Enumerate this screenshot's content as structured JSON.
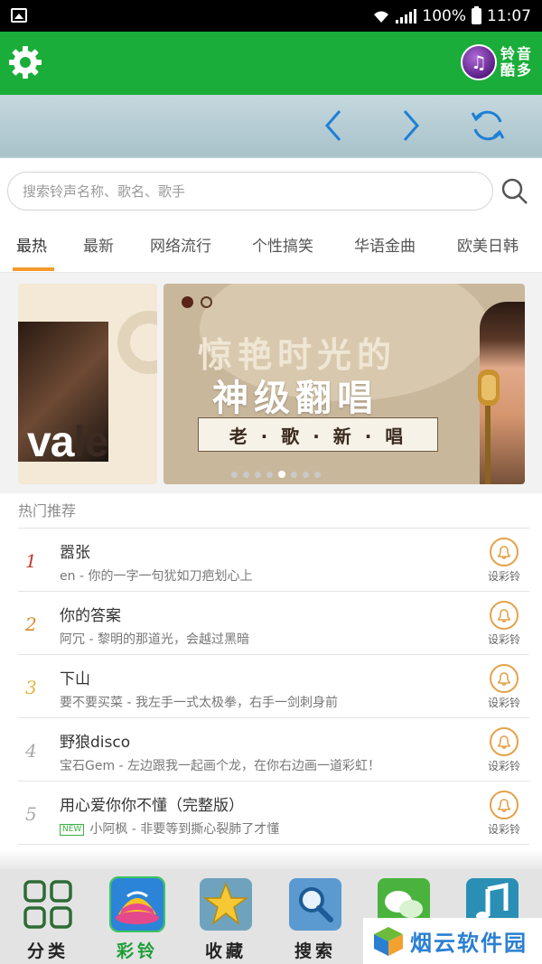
{
  "status_bar": {
    "battery": "100%",
    "time": "11:07"
  },
  "header": {
    "logo_text": [
      "铃",
      "音",
      "酷",
      "多"
    ]
  },
  "search": {
    "placeholder": "搜索铃声名称、歌名、歌手"
  },
  "tabs": [
    {
      "label": "最热",
      "active": true
    },
    {
      "label": "最新"
    },
    {
      "label": "网络流行"
    },
    {
      "label": "个性搞笑"
    },
    {
      "label": "华语金曲"
    },
    {
      "label": "欧美日韩"
    }
  ],
  "banner": {
    "left_text_a": "va",
    "left_text_b": "le",
    "main_line1": "惊艳时光的",
    "main_line2": "神级翻唱",
    "main_tag": "老 · 歌 · 新 · 唱",
    "dot_count": 8,
    "active_dot": 4
  },
  "hot": {
    "title": "热门推荐",
    "items": [
      {
        "rank": "1",
        "rank_color": "#c0392b",
        "title": "嚣张",
        "sub": "en - 你的一字一句犹如刀疤划心上",
        "action": "设彩铃"
      },
      {
        "rank": "2",
        "rank_color": "#d98a2b",
        "title": "你的答案",
        "sub": "阿冗 - 黎明的那道光，会越过黑暗",
        "action": "设彩铃"
      },
      {
        "rank": "3",
        "rank_color": "#e0b43a",
        "title": "下山",
        "sub": "要不要买菜 - 我左手一式太极拳，右手一剑刺身前",
        "action": "设彩铃"
      },
      {
        "rank": "4",
        "rank_color": "#aaaaaa",
        "title": "野狼disco",
        "sub": "宝石Gem - 左边跟我一起画个龙，在你右边画一道彩虹！",
        "action": "设彩铃"
      },
      {
        "rank": "5",
        "rank_color": "#aaaaaa",
        "title": "用心爱你你不懂（完整版）",
        "new_tag": "NEW",
        "sub": "小阿枫 - 非要等到撕心裂肺了才懂",
        "action": "设彩铃"
      }
    ]
  },
  "bottom_nav": [
    {
      "label": "分类"
    },
    {
      "label": "彩铃",
      "active": true
    },
    {
      "label": "收藏"
    },
    {
      "label": "搜索"
    },
    {
      "label": ""
    },
    {
      "label": ""
    }
  ],
  "watermark": {
    "text": "烟云软件园"
  },
  "colors": {
    "primary_green": "#1aad3a",
    "accent_orange": "#f39a2b",
    "ring_orange": "#e3a34a",
    "nav_blue": "#2a7fd1"
  }
}
